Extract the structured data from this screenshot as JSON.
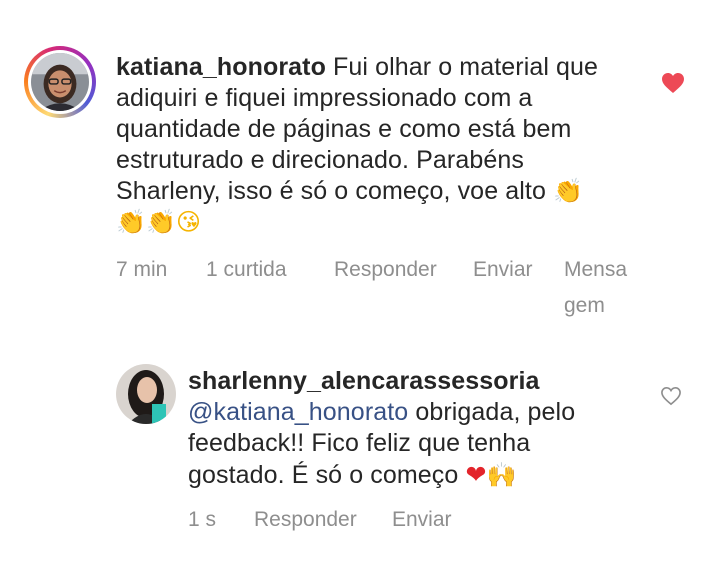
{
  "comments": [
    {
      "username": "katiana_honorato",
      "text": " Fui olhar o material que adiquiri e fiquei impressionado com a quantidade de páginas e como está bem estruturado e direcionado. Parabéns Sharleny, isso é só o começo, voe alto ",
      "emoji_after": [
        "clapping-hands",
        "clapping-hands",
        "clapping-hands",
        "face-blowing-kiss"
      ],
      "time": "7 min",
      "likes": "1 curtida",
      "reply_label": "Responder",
      "send_label": "Enviar",
      "message_label_line1": "Mensa",
      "message_label_line2": "gem",
      "liked": true,
      "like_icon_color": "#ed4956"
    },
    {
      "username": "sharlenny_alencarassessoria",
      "mention": "@katiana_honorato",
      "text": " obrigada, pelo feedback!! Fico feliz que tenha gostado. É só o começo ",
      "emoji_after": [
        "red-heart",
        "raising-hands"
      ],
      "time": "1 s",
      "reply_label": "Responder",
      "send_label": "Enviar",
      "liked": false,
      "like_icon_color": "#8e8e8e"
    }
  ]
}
